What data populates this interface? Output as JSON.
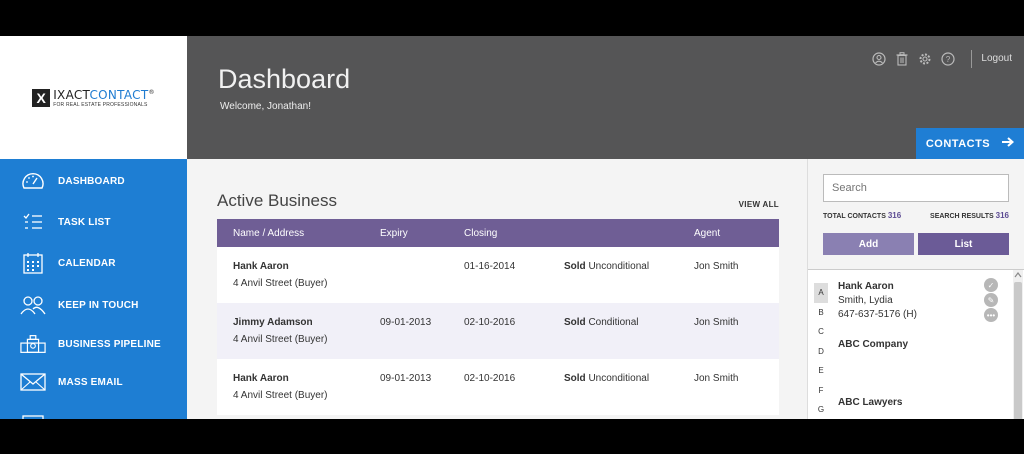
{
  "logo": {
    "mark": "X",
    "main_part1": "IXACT",
    "main_part2": "CONTACT",
    "reg": "®",
    "tagline": "FOR REAL ESTATE PROFESSIONALS"
  },
  "header": {
    "title": "Dashboard",
    "welcome": "Welcome,  Jonathan!",
    "logout": "Logout",
    "icons": [
      "user-icon",
      "trash-icon",
      "gear-icon",
      "help-icon"
    ]
  },
  "contacts_button": {
    "label": "CONTACTS",
    "icon": "arrow-right-icon"
  },
  "sidebar": {
    "items": [
      {
        "label": "DASHBOARD",
        "icon": "speedometer-icon"
      },
      {
        "label": "TASK LIST",
        "icon": "checklist-icon"
      },
      {
        "label": "CALENDAR",
        "icon": "calendar-icon"
      },
      {
        "label": "KEEP IN TOUCH",
        "icon": "people-icon"
      },
      {
        "label": "BUSINESS PIPELINE",
        "icon": "pipeline-icon"
      },
      {
        "label": "MASS EMAIL",
        "icon": "envelope-icon"
      }
    ]
  },
  "main": {
    "section_title": "Active Business",
    "view_all": "VIEW ALL",
    "columns": [
      "Name / Address",
      "Expiry",
      "Closing",
      "Agent"
    ],
    "rows": [
      {
        "name": "Hank Aaron",
        "address": "4 Anvil Street (Buyer)",
        "expiry": "",
        "closing": "01-16-2014",
        "status_bold": "Sold",
        "status": "Unconditional",
        "agent": "Jon Smith"
      },
      {
        "name": "Jimmy Adamson",
        "address": "4 Anvil Street (Buyer)",
        "expiry": "09-01-2013",
        "closing": "02-10-2016",
        "status_bold": "Sold",
        "status": "Conditional",
        "agent": "Jon Smith"
      },
      {
        "name": "Hank Aaron",
        "address": "4 Anvil Street (Buyer)",
        "expiry": "09-01-2013",
        "closing": "02-10-2016",
        "status_bold": "Sold",
        "status": "Unconditional",
        "agent": "Jon Smith"
      }
    ]
  },
  "right": {
    "search_placeholder": "Search",
    "total_label": "TOTAL CONTACTS",
    "total_value": "316",
    "results_label": "SEARCH RESULTS",
    "results_value": "316",
    "add_label": "Add",
    "list_label": "List",
    "alphabet": [
      "A",
      "B",
      "C",
      "D",
      "E",
      "F",
      "G"
    ],
    "contacts": [
      {
        "name": "Hank Aaron",
        "line2": "Smith, Lydia",
        "line3": "647-637-5176 (H)"
      },
      {
        "name": "ABC Company",
        "line2": "",
        "line3": ""
      },
      {
        "name": "ABC Lawyers",
        "line2": "",
        "line3": ""
      }
    ]
  }
}
